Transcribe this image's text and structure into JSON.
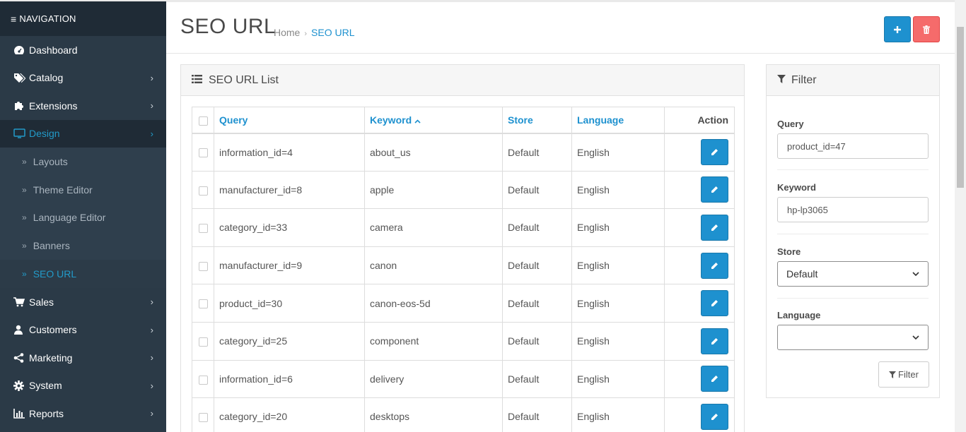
{
  "nav": {
    "header": "NAVIGATION",
    "items": [
      {
        "label": "Dashboard",
        "icon": "dashboard-icon",
        "chevron": false
      },
      {
        "label": "Catalog",
        "icon": "tags-icon",
        "chevron": true
      },
      {
        "label": "Extensions",
        "icon": "puzzle-icon",
        "chevron": true
      },
      {
        "label": "Design",
        "icon": "desktop-icon",
        "chevron": true,
        "active": true
      }
    ],
    "design_sub": [
      "Layouts",
      "Theme Editor",
      "Language Editor",
      "Banners",
      "SEO URL"
    ],
    "items_after": [
      {
        "label": "Sales",
        "icon": "cart-icon"
      },
      {
        "label": "Customers",
        "icon": "user-icon"
      },
      {
        "label": "Marketing",
        "icon": "share-icon"
      },
      {
        "label": "System",
        "icon": "gear-icon"
      },
      {
        "label": "Reports",
        "icon": "bar-chart-icon"
      }
    ]
  },
  "header": {
    "title": "SEO URL",
    "breadcrumb": [
      "Home",
      "SEO URL"
    ]
  },
  "list": {
    "heading": "SEO URL List",
    "columns": {
      "query": "Query",
      "keyword": "Keyword",
      "store": "Store",
      "language": "Language",
      "action": "Action"
    },
    "rows": [
      {
        "query": "information_id=4",
        "keyword": "about_us",
        "store": "Default",
        "language": "English"
      },
      {
        "query": "manufacturer_id=8",
        "keyword": "apple",
        "store": "Default",
        "language": "English"
      },
      {
        "query": "category_id=33",
        "keyword": "camera",
        "store": "Default",
        "language": "English"
      },
      {
        "query": "manufacturer_id=9",
        "keyword": "canon",
        "store": "Default",
        "language": "English"
      },
      {
        "query": "product_id=30",
        "keyword": "canon-eos-5d",
        "store": "Default",
        "language": "English"
      },
      {
        "query": "category_id=25",
        "keyword": "component",
        "store": "Default",
        "language": "English"
      },
      {
        "query": "information_id=6",
        "keyword": "delivery",
        "store": "Default",
        "language": "English"
      },
      {
        "query": "category_id=20",
        "keyword": "desktops",
        "store": "Default",
        "language": "English"
      }
    ]
  },
  "filter": {
    "heading": "Filter",
    "query_label": "Query",
    "query_value": "product_id=47",
    "keyword_label": "Keyword",
    "keyword_value": "hp-lp3065",
    "store_label": "Store",
    "store_value": "Default",
    "language_label": "Language",
    "language_value": "",
    "button": "Filter"
  },
  "colors": {
    "sidebar": "#2b3a47",
    "accent": "#1e91cf",
    "danger": "#f56b6b"
  }
}
